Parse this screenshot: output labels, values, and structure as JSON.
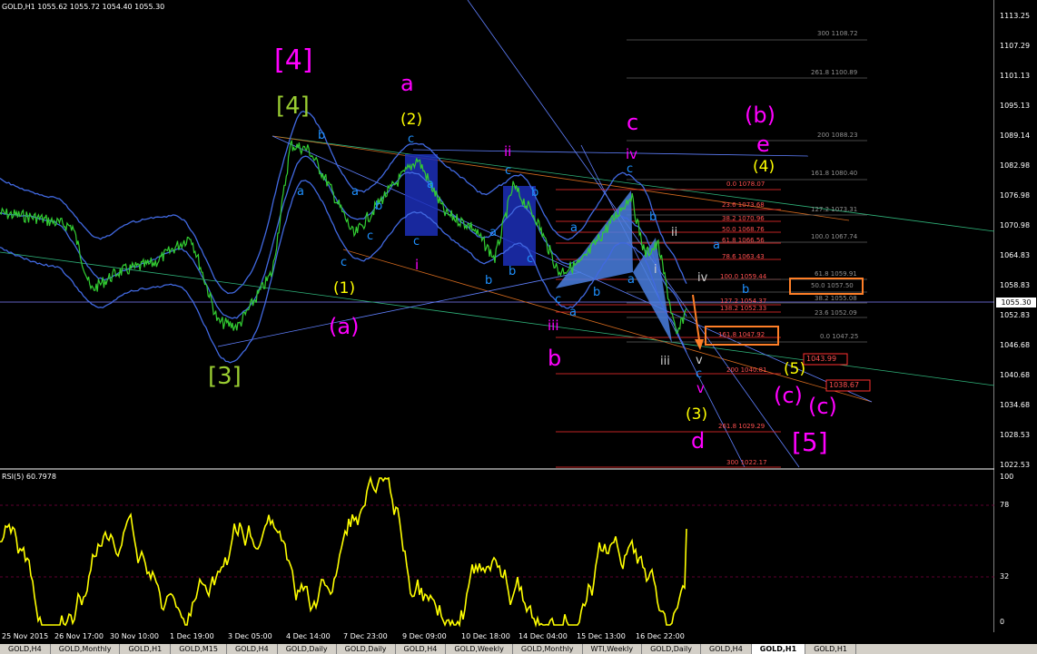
{
  "header": {
    "symbol_info": "GOLD,H1  1055.62 1055.72 1054.40 1055.30"
  },
  "rsi": {
    "label": "RSI(5) 60.7978",
    "ticks": [
      "100",
      "78",
      "32",
      "0"
    ],
    "levels": [
      78,
      32
    ]
  },
  "price_axis": {
    "ticks": [
      "1113.25",
      "1107.29",
      "1101.13",
      "1095.13",
      "1089.14",
      "1082.98",
      "1076.98",
      "1070.98",
      "1064.83",
      "1058.83",
      "1052.83",
      "1046.68",
      "1040.68",
      "1034.68",
      "1028.53",
      "1022.53"
    ],
    "current_price": "1055.30"
  },
  "time_axis": {
    "ticks": [
      "25 Nov 2015",
      "26 Nov 17:00",
      "30 Nov 10:00",
      "1 Dec 19:00",
      "3 Dec 05:00",
      "4 Dec 14:00",
      "7 Dec 23:00",
      "9 Dec 09:00",
      "10 Dec 18:00",
      "14 Dec 04:00",
      "15 Dec 13:00",
      "16 Dec 22:00"
    ]
  },
  "tabs": [
    {
      "label": "GOLD,H4",
      "active": false
    },
    {
      "label": "GOLD,Monthly",
      "active": false
    },
    {
      "label": "GOLD,H1",
      "active": false
    },
    {
      "label": "GOLD,M15",
      "active": false
    },
    {
      "label": "GOLD,H4",
      "active": false
    },
    {
      "label": "GOLD,Daily",
      "active": false
    },
    {
      "label": "GOLD,Daily",
      "active": false
    },
    {
      "label": "GOLD,H4",
      "active": false
    },
    {
      "label": "GOLD,Weekly",
      "active": false
    },
    {
      "label": "GOLD,Monthly",
      "active": false
    },
    {
      "label": "WTI,Weekly",
      "active": false
    },
    {
      "label": "GOLD,Daily",
      "active": false
    },
    {
      "label": "GOLD,H4",
      "active": false
    },
    {
      "label": "GOLD,H1",
      "active": true
    },
    {
      "label": "GOLD,H1",
      "active": false
    }
  ],
  "wave_labels": {
    "l4_magenta": "[4]",
    "l4_green": "[4]",
    "l3_green": "[3]",
    "l5_magenta": "[5]",
    "a_top": "a",
    "b_mid": "b",
    "c_top": "c",
    "d_low": "d",
    "e_right": "e",
    "b_paren": "(b)",
    "a_paren": "(a)",
    "c_paren1": "(c)",
    "c_paren2": "(c)",
    "y1": "(1)",
    "y2": "(2)",
    "y3": "(3)",
    "y4": "(4)",
    "y5": "(5)",
    "ii_pink": "ii",
    "iii_pink": "iii",
    "iv_pink": "iv",
    "v_pink": "v",
    "i_pink": "i",
    "ii_white": "ii",
    "iii_white": "iii",
    "iv_white": "iv",
    "v_white": "v",
    "i_white": "i",
    "blue_a": "a",
    "blue_b": "b",
    "blue_c": "c"
  },
  "fib_levels_upper": [
    {
      "text": "300 1108.72"
    },
    {
      "text": "261.8 1100.89"
    },
    {
      "text": "200 1088.23"
    },
    {
      "text": "161.8 1080.40"
    },
    {
      "text": "127.2 1073.31"
    },
    {
      "text": "100.0 1067.74"
    },
    {
      "text": "61.8 1059.91"
    },
    {
      "text": "50.0 1057.50"
    },
    {
      "text": "38.2 1055.08"
    },
    {
      "text": "23.6 1052.09"
    },
    {
      "text": "0.0 1047.25"
    }
  ],
  "fib_levels_lower": [
    {
      "text": "0.0 1078.07"
    },
    {
      "text": "23.6 1073.68"
    },
    {
      "text": "38.2 1070.96"
    },
    {
      "text": "50.0 1068.76"
    },
    {
      "text": "61.8 1066.56"
    },
    {
      "text": "78.6 1063.43"
    },
    {
      "text": "100.0 1059.44"
    },
    {
      "text": "127.2 1054.37"
    },
    {
      "text": "138.2 1052.33"
    },
    {
      "text": "161.8 1047.92"
    },
    {
      "text": "200 1040.81"
    },
    {
      "text": "261.8 1029.29"
    },
    {
      "text": "300 1022.17"
    }
  ],
  "price_boxes": {
    "box1": "1043.99",
    "box2": "1038.67"
  },
  "colors": {
    "background": "#000000",
    "price_line": "#32cd32",
    "bollinger": "#4169e1",
    "rsi_line": "#ffff00",
    "magenta_labels": "#ff00ff",
    "green_labels": "#9acd32",
    "yellow_labels": "#ffff00",
    "blue_labels": "#1e90ff",
    "fib_red": "#ff3030",
    "highlight_orange": "#ff7f27"
  }
}
